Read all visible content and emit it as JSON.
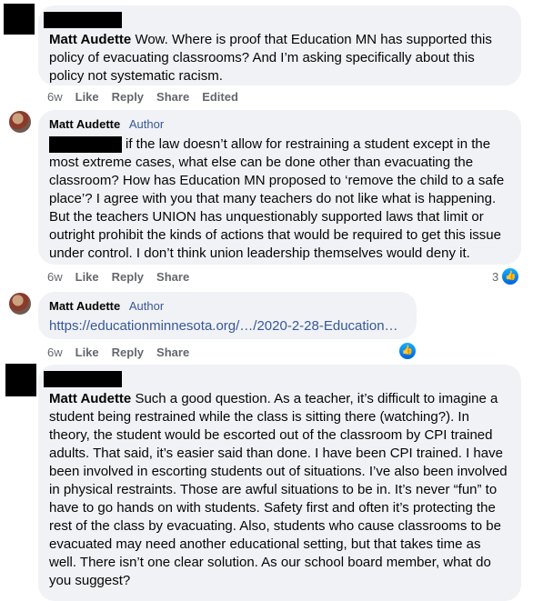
{
  "comments": [
    {
      "author": "Matt Audette",
      "text": "Wow. Where is proof that Education MN has supported this policy of evacuating classrooms? And I’m asking specifically about this policy not systematic racism.",
      "time": "6w",
      "like": "Like",
      "reply": "Reply",
      "share": "Share",
      "edited": "Edited"
    },
    {
      "author": "Matt Audette",
      "badge": "Author",
      "text": "if the law doesn’t allow for restraining a student except in the most extreme cases, what else can be done other than evacuating the classroom? How has Education MN proposed to ‘remove the child to a safe place’? I agree with you that many teachers do not like what is happening. But the teachers UNION has unquestionably supported laws that limit or outright prohibit the kinds of actions that would be required to get this issue under control. I don’t think union leadership themselves would deny it.",
      "time": "6w",
      "like": "Like",
      "reply": "Reply",
      "share": "Share",
      "reaction_count": "3"
    },
    {
      "author": "Matt Audette",
      "badge": "Author",
      "link": "https://educationminnesota.org/…/2020-2-28-Education…",
      "time": "6w",
      "like": "Like",
      "reply": "Reply",
      "share": "Share"
    },
    {
      "author": "Matt Audette",
      "text": "Such a good question. As a teacher, it’s difficult to imagine a student being restrained while the class is sitting there (watching?). In theory, the student would be escorted out of the classroom by CPI trained adults. That said, it’s easier said than done. I have been CPI trained. I have been involved in escorting students out of situations. I’ve also been involved in physical restraints. Those are awful situations to be in. It’s never “fun” to have to go hands on with students. Safety first and often it’s protecting the rest of the class by evacuating. Also, students who cause classrooms to be evacuated may need another educational setting, but that takes time as well. There isn’t one clear solution. As our school board member, what do you suggest?"
    }
  ],
  "icons": {
    "reaction": "like-icon"
  },
  "colors": {
    "bubble": "#f0f2f5",
    "link": "#385898",
    "meta": "#65676b",
    "like_blue": "#1877f2"
  }
}
